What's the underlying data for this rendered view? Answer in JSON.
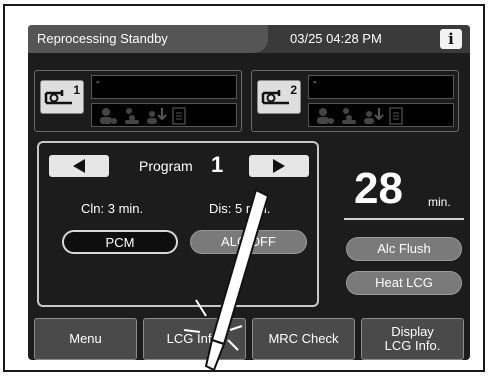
{
  "header": {
    "status": "Reprocessing Standby",
    "datetime": "03/25 04:28 PM",
    "info_label": "i"
  },
  "scopes": [
    {
      "number": "1",
      "id_text": "-"
    },
    {
      "number": "2",
      "id_text": "-"
    }
  ],
  "program": {
    "label": "Program",
    "number": "1",
    "cln_time": "Cln: 3 min.",
    "dis_time": "Dis: 5 min.",
    "pcm_label": "PCM",
    "alc_label": "ALC OFF"
  },
  "timer": {
    "value": "28",
    "unit": "min."
  },
  "side_buttons": {
    "alc_flush": "Alc Flush",
    "heat_lcg": "Heat LCG"
  },
  "bottom_bar": {
    "menu": "Menu",
    "lcg_info": "LCG Info.",
    "mrc_check": "MRC Check",
    "display_lcg_line1": "Display",
    "display_lcg_line2": "LCG Info."
  },
  "colors": {
    "screen_bg": "#1c1c1c",
    "button_gray": "#7a7a7a",
    "header_tab": "#555555"
  },
  "icons": [
    "scope-icon",
    "person-icon",
    "group-icon",
    "download-icon",
    "document-icon",
    "arrow-left-icon",
    "arrow-right-icon",
    "info-icon",
    "stylus-icon"
  ]
}
